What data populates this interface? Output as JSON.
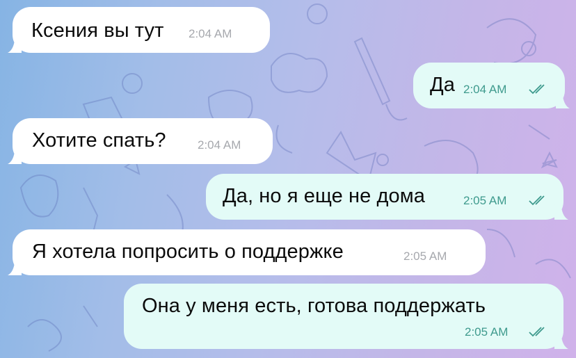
{
  "chat": {
    "messages": [
      {
        "direction": "incoming",
        "text": "Ксения вы тут",
        "time": "2:04 AM"
      },
      {
        "direction": "outgoing",
        "text": "Да",
        "time": "2:04 AM",
        "status": "read"
      },
      {
        "direction": "incoming",
        "text": "Хотите спать?",
        "time": "2:04 AM"
      },
      {
        "direction": "outgoing",
        "text": "Да, но я еще не дома",
        "time": "2:05 AM",
        "status": "read"
      },
      {
        "direction": "incoming",
        "text": "Я хотела попросить о поддержке",
        "time": "2:05 AM"
      },
      {
        "direction": "outgoing",
        "text": "Она у меня есть, готова поддержать",
        "time": "2:05 AM",
        "status": "read"
      }
    ]
  },
  "colors": {
    "incoming_bubble": "#ffffff",
    "outgoing_bubble": "#e3fbf7",
    "outgoing_time": "#3e9a8d",
    "incoming_time": "#a6a8ad",
    "read_checks": "#3e9a8d"
  },
  "icons": {
    "read_status": "double-check-icon"
  }
}
